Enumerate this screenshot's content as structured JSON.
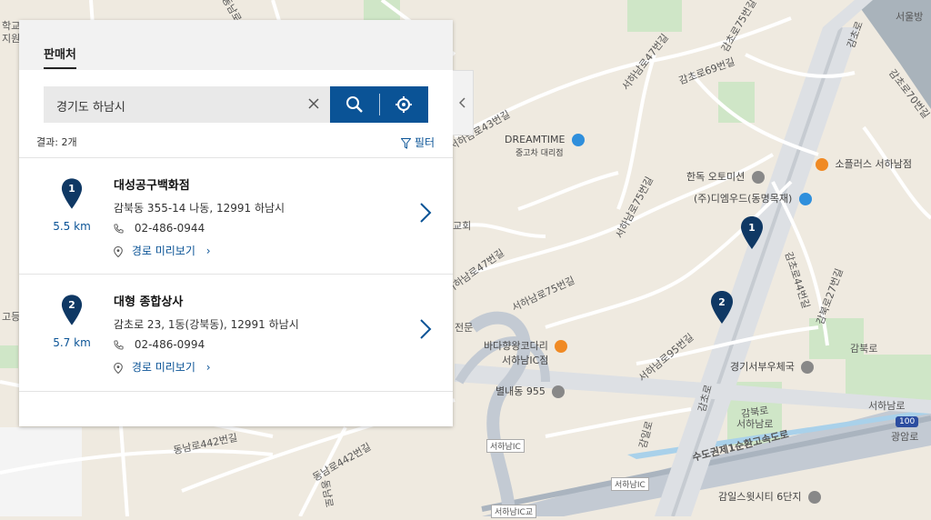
{
  "panel": {
    "tab_label": "판매처",
    "search": {
      "value": "경기도 하남시",
      "placeholder": ""
    },
    "result_count": "결과: 2개",
    "filter_label": "필터",
    "collapse_icon": "chevron-left-icon"
  },
  "results": [
    {
      "index": "1",
      "distance": "5.5 km",
      "name": "대성공구백화점",
      "address": "감북동 355-14 나동, 12991 하남시",
      "phone": "02-486-0944",
      "route": "경로 미리보기",
      "route_chevron": "›"
    },
    {
      "index": "2",
      "distance": "5.7 km",
      "name": "대형 종합상사",
      "address": "감초로 23, 1동(강북동), 12991 하남시",
      "phone": "02-486-0994",
      "route": "경로 미리보기",
      "route_chevron": "›"
    }
  ],
  "map": {
    "labels": {
      "l1": "동남로",
      "l2": "감초로69번길",
      "l3": "서하남로47번길",
      "l4": "감초로75번길",
      "l5": "감초로",
      "l6": "서울방",
      "l7": "감초로70번길",
      "l8": "서하남로43번길",
      "l9": "서하남로75번길",
      "l10": "감초로44번길",
      "l11": "감북로27번길",
      "l12": "서하남로47번길",
      "l13": "서하남로75번길",
      "l14": "서하남로95번길",
      "l15": "감북로",
      "l16": "감북로",
      "l17": "서하남로",
      "l18": "서하남로",
      "l19": "감일로",
      "l20": "동남로442번길",
      "l21": "동남로442번길",
      "l22": "수도권제1순환고속도로",
      "l23": "광암로",
      "l24": "서하남IC",
      "l25": "서하남IC",
      "l26": "서하남IC교",
      "l27": "감초로",
      "l28": "동남로",
      "l29": "학교",
      "l30": "지원",
      "l31": "고등",
      "l32": "교회",
      "l33": "전문"
    },
    "pois": {
      "dreamtime": "DREAMTIME",
      "dreamtime_sub": "중고차 대리점",
      "hanok": "한독 오토미션",
      "diemwood": "(주)디엠우드(동명목재)",
      "soplus": "소플러스 서하남점",
      "badahyang": "바다향왕코다리",
      "badahyang_sub": "서하남IC점",
      "byeolnae": "별내동 955",
      "post": "경기서부우체국",
      "gamil": "감일스윗시티 6단지",
      "highway_no": "100"
    }
  },
  "colors": {
    "accent": "#0a5396",
    "marker": "#0f3864",
    "food": "#f08a24",
    "shop": "#2f8fdc"
  }
}
